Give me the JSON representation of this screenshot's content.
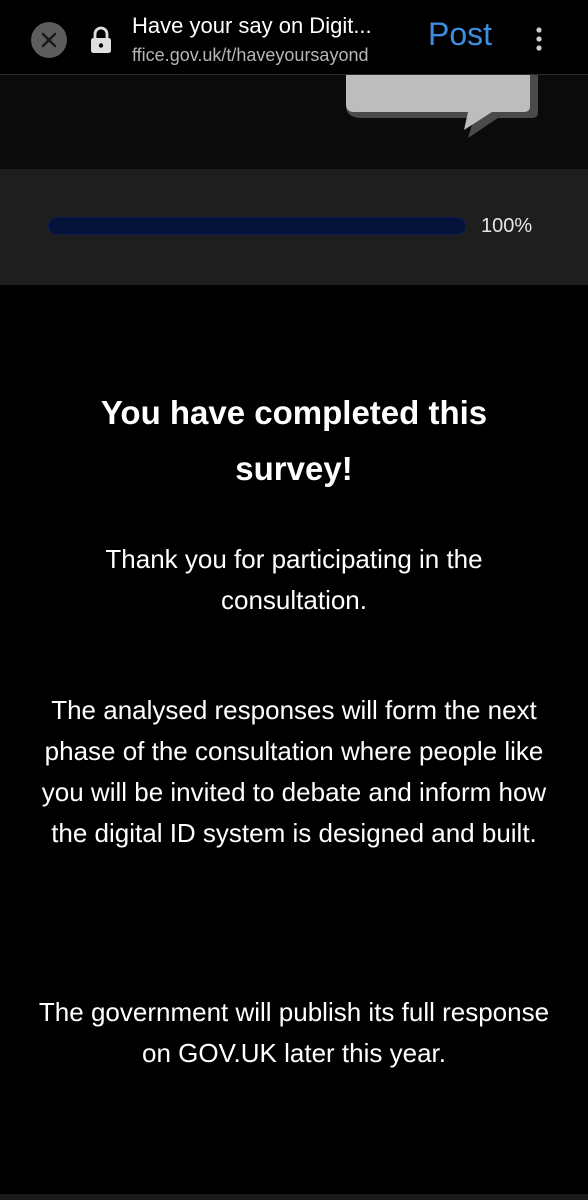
{
  "browser": {
    "tab_title": "Have your say on Digit...",
    "url": "ffice.gov.uk/t/haveyoursayond",
    "post_label": "Post",
    "icons": [
      "close-icon",
      "lock-icon",
      "more-vert-icon"
    ],
    "accent_color": "#3c8ee0"
  },
  "survey": {
    "progress_percent": 100,
    "progress_label": "100%",
    "title": "You have completed this survey!",
    "paragraphs": [
      "Thank you for participating in the consultation.",
      "The analysed responses will form the next phase of the consultation where people like you will be invited to debate and inform how the digital ID system is designed and built.",
      "The government will publish its full response on GOV.UK later this year."
    ]
  }
}
